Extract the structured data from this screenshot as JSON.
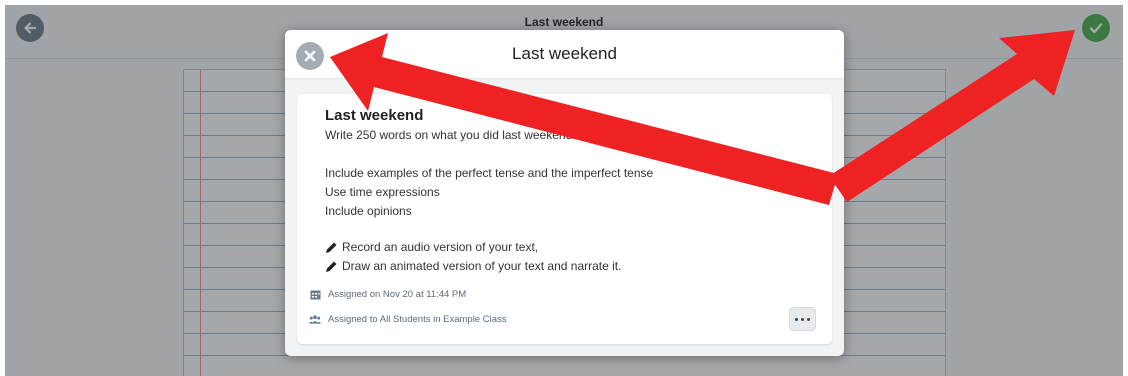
{
  "app": {
    "title": "Last weekend",
    "back_icon": "arrow-left-icon",
    "done_icon": "checkmark-icon",
    "done_color": "#47b04b"
  },
  "modal": {
    "title": "Last weekend",
    "close_icon": "close-icon"
  },
  "assignment": {
    "title": "Last weekend",
    "lines": [
      "Write 250 words on what you did last weekend.",
      "",
      "Include examples of the perfect tense and the imperfect tense",
      "Use time expressions",
      "Include opinions",
      ""
    ],
    "tasks": [
      "Record an audio version of your text,",
      "Draw an animated version of your text and narrate it."
    ],
    "task_icon": "pencil-icon",
    "assigned_on": "Assigned on Nov 20 at 11:44 PM",
    "assigned_to": "Assigned to All Students in Example Class",
    "calendar_icon": "calendar-icon",
    "group_icon": "group-icon",
    "more_icon": "ellipsis-icon"
  },
  "annotation": {
    "arrow_color": "#ee2222"
  }
}
